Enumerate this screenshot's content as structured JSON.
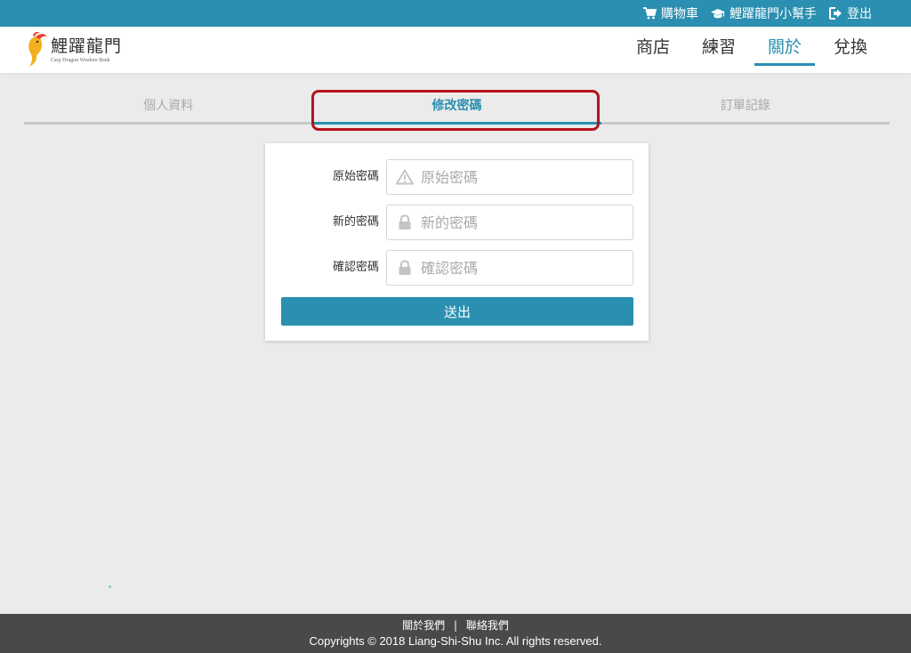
{
  "topbar": {
    "cart_label": "購物車",
    "helper_label": "鯉躍龍門小幫手",
    "logout_label": "登出"
  },
  "brand": {
    "title": "鯉躍龍門",
    "subtitle": "Carp Dragon Wisdom Bank",
    "accent_color": "#2a8fb0",
    "fish_colors": [
      "#f2b01e",
      "#e8412c"
    ]
  },
  "nav": {
    "items": [
      {
        "label": "商店"
      },
      {
        "label": "練習"
      },
      {
        "label": "關於",
        "active": true
      },
      {
        "label": "兌換"
      }
    ]
  },
  "tabs": [
    {
      "label": "個人資料"
    },
    {
      "label": "修改密碼",
      "active": true
    },
    {
      "label": "訂單記錄"
    }
  ],
  "form": {
    "old_password": {
      "label": "原始密碼",
      "placeholder": "原始密碼",
      "value": "",
      "icon": "warning-icon"
    },
    "new_password": {
      "label": "新的密碼",
      "placeholder": "新的密碼",
      "value": "",
      "icon": "lock-icon"
    },
    "confirm_password": {
      "label": "確認密碼",
      "placeholder": "確認密碼",
      "value": "",
      "icon": "lock-icon"
    },
    "submit_label": "送出"
  },
  "footer": {
    "about_label": "關於我們",
    "separator": "|",
    "contact_label": "聯絡我們",
    "copyright": "Copyrights © 2018 Liang-Shi-Shu Inc. All rights reserved."
  }
}
